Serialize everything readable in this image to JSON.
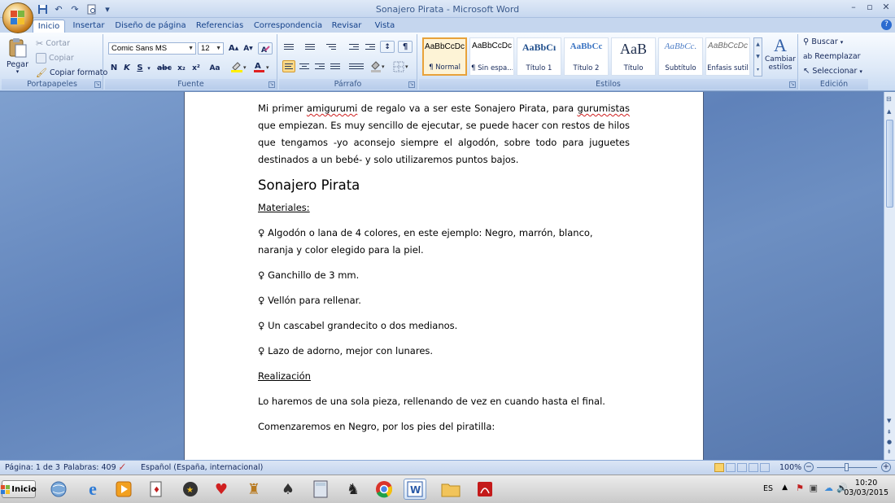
{
  "window": {
    "title": "Sonajero Pirata - Microsoft Word",
    "controls": [
      "–",
      "▫",
      "✕"
    ]
  },
  "qat": {
    "dropdown": "▾"
  },
  "tabs": [
    {
      "label": "Inicio",
      "active": true
    },
    {
      "label": "Insertar"
    },
    {
      "label": "Diseño de página"
    },
    {
      "label": "Referencias"
    },
    {
      "label": "Correspondencia"
    },
    {
      "label": "Revisar"
    },
    {
      "label": "Vista"
    }
  ],
  "ribbon": {
    "clipboard": {
      "paste": "Pegar",
      "cut": "Cortar",
      "copy": "Copiar",
      "format_painter": "Copiar formato",
      "label": "Portapapeles"
    },
    "font": {
      "font_name": "Comic Sans MS",
      "font_size": "12",
      "label": "Fuente",
      "buttons": [
        "N",
        "K",
        "S",
        "abc",
        "x₂",
        "x²",
        "Aa"
      ]
    },
    "paragraph": {
      "label": "Párrafo"
    },
    "styles": {
      "label": "Estilos",
      "items": [
        {
          "sample": "AaBbCcDc",
          "name": "¶ Normal",
          "selected": true
        },
        {
          "sample": "AaBbCcDc",
          "name": "¶ Sin espa..."
        },
        {
          "sample": "AaBbCı",
          "name": "Título 1"
        },
        {
          "sample": "AaBbCc",
          "name": "Título 2"
        },
        {
          "sample": "AaB",
          "name": "Título"
        },
        {
          "sample": "AaBbCc.",
          "name": "Subtítulo"
        },
        {
          "sample": "AaBbCcDc",
          "name": "Énfasis sutil"
        }
      ],
      "change": "Cambiar estilos"
    },
    "editing": {
      "label": "Edición",
      "find": "Buscar",
      "replace": "Reemplazar",
      "select": "Seleccionar"
    }
  },
  "document": {
    "intro": {
      "pre1": "Mi primer ",
      "sp1": "amigurumi",
      "mid1": " de regalo va a ser este Sonajero Pirata, para ",
      "sp2": "gurumistas",
      "rest": " que empiezan. Es muy sencillo de ejecutar, se puede hacer con restos de hilos que tengamos -yo aconsejo siempre el algodón, sobre todo para juguetes destinados a un bebé- y solo utilizaremos puntos bajos."
    },
    "heading": "Sonajero Pirata",
    "materials_title": "Materiales:",
    "materials": [
      "♀ Algodón o lana de 4 colores, en este ejemplo: Negro, marrón, blanco, naranja y color elegido para la piel.",
      "♀ Ganchillo de 3 mm.",
      "♀ Vellón para rellenar.",
      "♀  Un cascabel grandecito o dos medianos.",
      "♀ Lazo de adorno, mejor con lunares."
    ],
    "realization_title": "Realización",
    "paragraphs": [
      "Lo haremos de una sola pieza, rellenando de vez en cuando hasta el final.",
      "Comenzaremos en Negro, por los pies del piratilla:"
    ]
  },
  "status": {
    "page": "Página: 1 de 3",
    "words": "Palabras: 409",
    "language": "Español (España, internacional)",
    "zoom": "100%"
  },
  "taskbar": {
    "start": "Inicio",
    "lang": "ES",
    "time": "10:20",
    "date": "03/03/2015"
  }
}
